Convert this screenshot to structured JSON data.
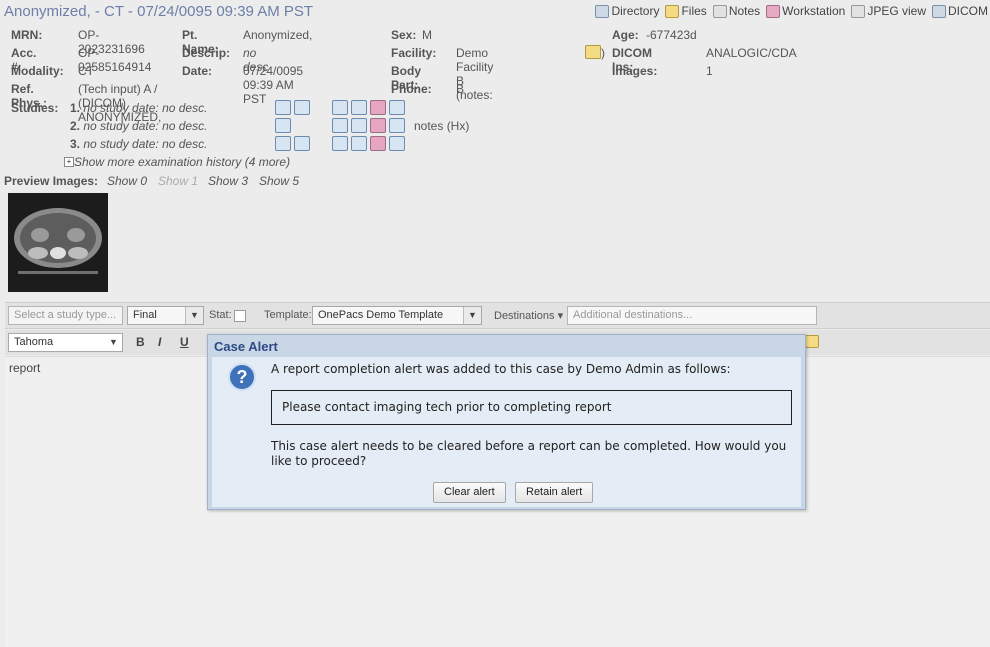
{
  "page_title": "Anonymized, - CT - 07/24/0095 09:39 AM PST",
  "nav": [
    {
      "label": "Directory",
      "icon": "directory-icon"
    },
    {
      "label": "Files",
      "icon": "folder-icon"
    },
    {
      "label": "Notes",
      "icon": "notes-icon"
    },
    {
      "label": "Workstation",
      "icon": "workstation-icon"
    },
    {
      "label": "JPEG view",
      "icon": "jpeg-icon"
    },
    {
      "label": "DICOM",
      "icon": "dicom-icon"
    }
  ],
  "info": {
    "mrn_label": "MRN:",
    "mrn": "OP-2023231696",
    "acc_label": "Acc. #:",
    "acc": "OP-02585164914",
    "modality_label": "Modality:",
    "modality": "CT",
    "refphys_label": "Ref. Phys.:",
    "refphys": "(Tech input) A / (DICOM) ANONYMIZED,",
    "ptname_label": "Pt. Name:",
    "ptname": "Anonymized,",
    "descrip_label": "Descrip:",
    "descrip": "no desc",
    "date_label": "Date:",
    "date": "07/24/0095 09:39 AM PST",
    "sex_label": "Sex:",
    "sex": "M",
    "facility_label": "Facility:",
    "facility": "Demo Facility B (notes:",
    "facility_close": ")",
    "bodypart_label": "Body Part:",
    "bodypart": "",
    "phone_label": "Phone:",
    "phone": "B",
    "age_label": "Age:",
    "age": "-677423d",
    "dicomins_label": "DICOM Ins:",
    "dicomins": "ANALOGIC/CDA",
    "images_label": "Images:",
    "images": "1"
  },
  "studies": {
    "label": "Studies:",
    "items": [
      {
        "num": "1.",
        "text": "no study date: no desc."
      },
      {
        "num": "2.",
        "text": "no study date: no desc."
      },
      {
        "num": "3.",
        "text": "no study date: no desc."
      }
    ],
    "notes": "notes (Hx)",
    "show_more": "Show more examination history (4 more)"
  },
  "preview": {
    "label": "Preview Images:",
    "links": [
      "Show 0",
      "Show 1",
      "Show 3",
      "Show 5"
    ]
  },
  "toolbar": {
    "study_type_placeholder": "Select a study type...",
    "status": "Final",
    "stat_label": "Stat:",
    "template_label": "Template:",
    "template": "OnePacs Demo Template",
    "destinations": "Destinations",
    "additional_placeholder": "Additional destinations...",
    "font": "Tahoma",
    "bold": "B",
    "italic": "I",
    "underline": "U"
  },
  "editor": {
    "text": "report"
  },
  "dialog": {
    "title": "Case Alert",
    "message": "A report completion alert was added to this case by Demo Admin as follows:",
    "alert_text": "Please contact imaging tech prior to completing report",
    "question": "This case alert needs to be cleared before a report can be completed. How would you like to proceed?",
    "clear_button": "Clear alert",
    "retain_button": "Retain alert"
  }
}
